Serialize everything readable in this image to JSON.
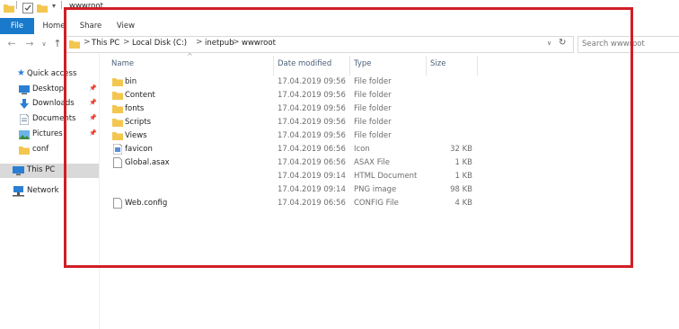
{
  "window": {
    "title": "wwwroot",
    "qa_separator": "|"
  },
  "ribbon": {
    "tabs": [
      "File",
      "Home",
      "Share",
      "View"
    ]
  },
  "address": {
    "breadcrumb_arrow": ">",
    "segments": [
      "This PC",
      "Local Disk (C:)",
      "inetpub",
      "wwwroot"
    ]
  },
  "search": {
    "placeholder": "Search wwwroot"
  },
  "nav": {
    "quick_access": "Quick access",
    "items": [
      {
        "label": "Desktop",
        "icon": "desktop-icon",
        "pinned": true
      },
      {
        "label": "Downloads",
        "icon": "download-icon",
        "pinned": true
      },
      {
        "label": "Documents",
        "icon": "documents-icon",
        "pinned": true
      },
      {
        "label": "Pictures",
        "icon": "pictures-icon",
        "pinned": true
      },
      {
        "label": "conf",
        "icon": "folder-icon",
        "pinned": false
      }
    ],
    "this_pc": "This PC",
    "network": "Network"
  },
  "columns": {
    "name": "Name",
    "date": "Date modified",
    "type": "Type",
    "size": "Size"
  },
  "files": [
    {
      "name": "bin",
      "date": "17.04.2019 09:56",
      "type": "File folder",
      "size": "",
      "icon": "folder-icon"
    },
    {
      "name": "Content",
      "date": "17.04.2019 09:56",
      "type": "File folder",
      "size": "",
      "icon": "folder-icon"
    },
    {
      "name": "fonts",
      "date": "17.04.2019 09:56",
      "type": "File folder",
      "size": "",
      "icon": "folder-icon"
    },
    {
      "name": "Scripts",
      "date": "17.04.2019 09:56",
      "type": "File folder",
      "size": "",
      "icon": "folder-icon"
    },
    {
      "name": "Views",
      "date": "17.04.2019 09:56",
      "type": "File folder",
      "size": "",
      "icon": "folder-icon"
    },
    {
      "name": "favicon",
      "date": "17.04.2019 06:56",
      "type": "Icon",
      "size": "32 KB",
      "icon": "icon-file-icon"
    },
    {
      "name": "Global.asax",
      "date": "17.04.2019 06:56",
      "type": "ASAX File",
      "size": "1 KB",
      "icon": "document-icon"
    },
    {
      "name": "",
      "date": "17.04.2019 09:14",
      "type": "HTML Document",
      "size": "1 KB",
      "icon": ""
    },
    {
      "name": "",
      "date": "17.04.2019 09:14",
      "type": "PNG image",
      "size": "98 KB",
      "icon": ""
    },
    {
      "name": "Web.config",
      "date": "17.04.2019 06:56",
      "type": "CONFIG File",
      "size": "4 KB",
      "icon": "document-icon"
    }
  ],
  "colors": {
    "accent": "#1979ca",
    "folder": "#f3c650",
    "highlight": "#d01e25",
    "selection": "#d9d9d9"
  }
}
